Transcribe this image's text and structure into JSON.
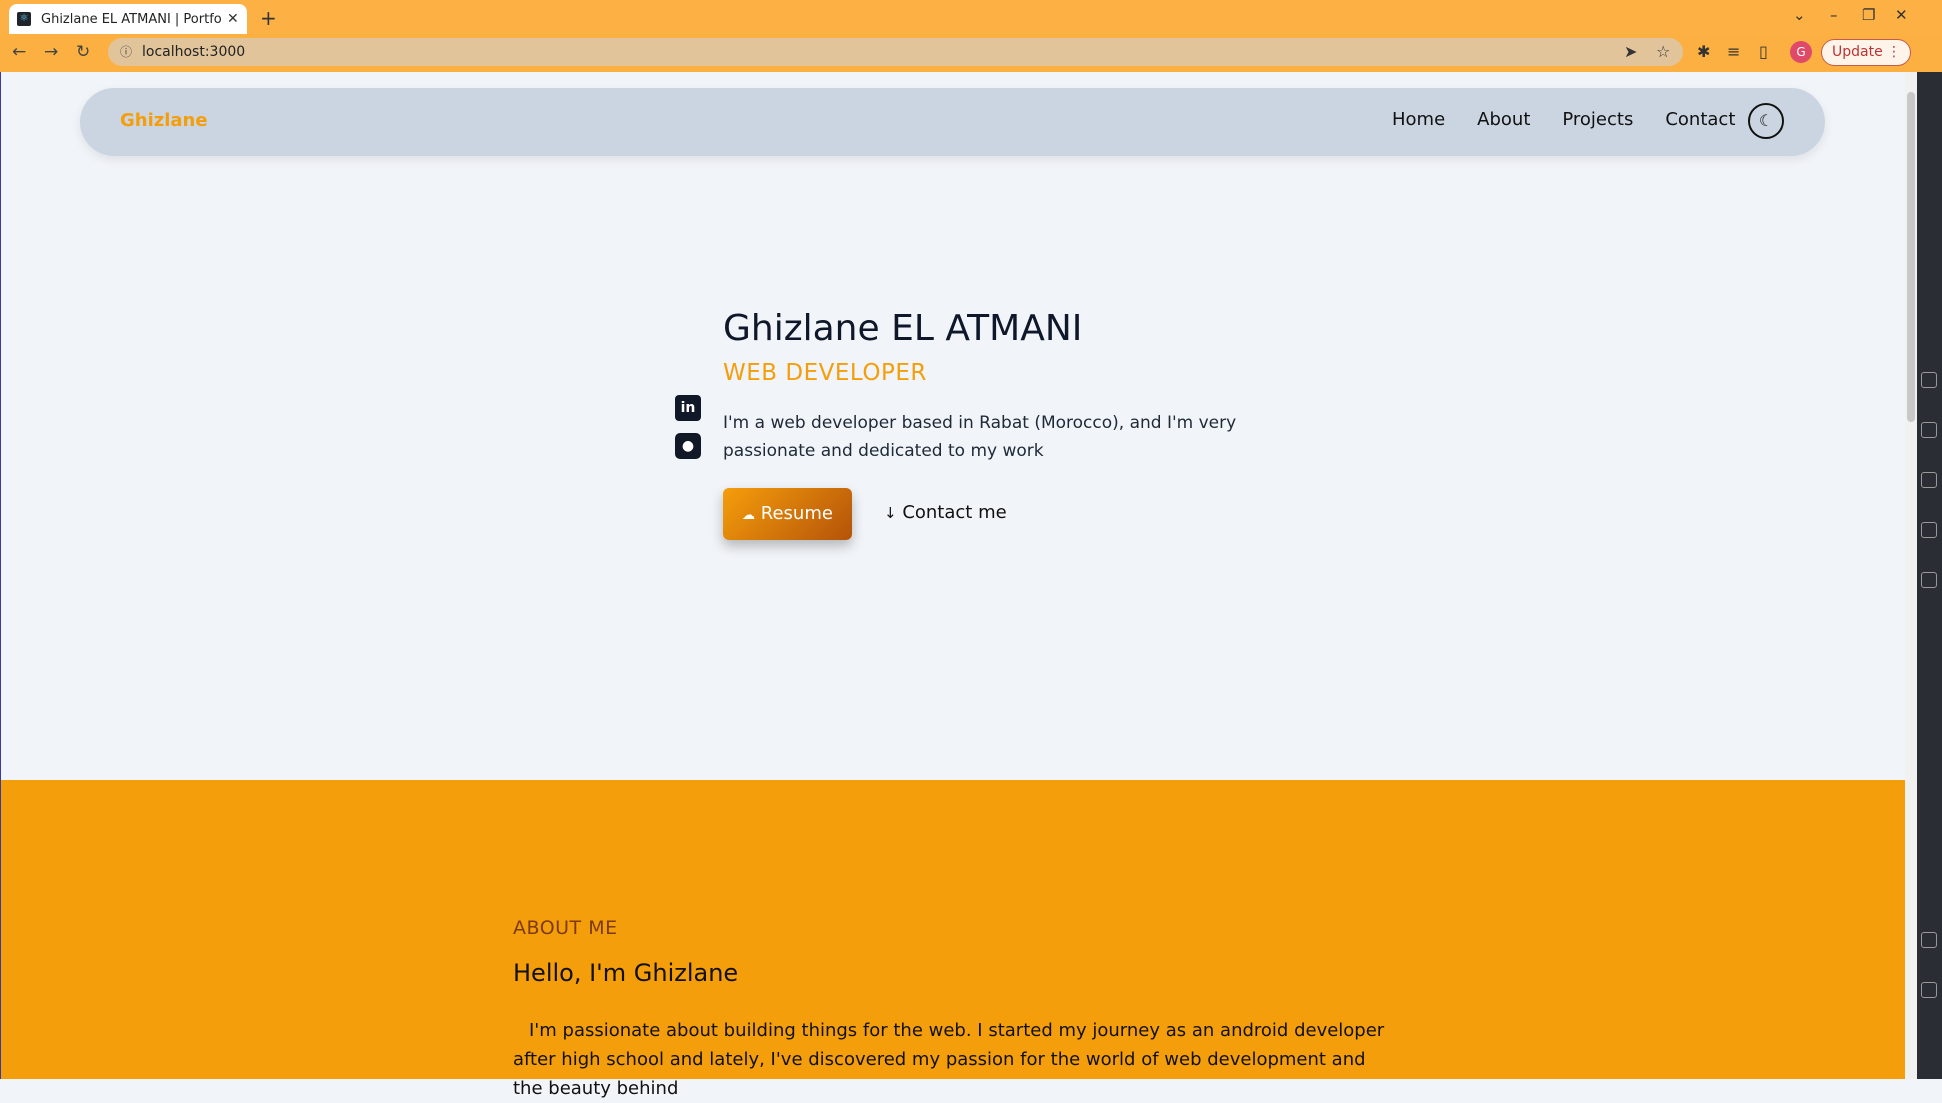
{
  "browser": {
    "tab_title": "Ghizlane EL ATMANI | Portfolio",
    "url": "localhost:3000",
    "update_label": "Update",
    "profile_initial": "G"
  },
  "nav": {
    "brand": "Ghizlane",
    "links": [
      "Home",
      "About",
      "Projects",
      "Contact"
    ]
  },
  "hero": {
    "name": "Ghizlane EL ATMANI",
    "role": "WEB DEVELOPER",
    "description": "I'm a web developer based in Rabat (Morocco), and I'm very passionate and dedicated to my work",
    "resume_label": "Resume",
    "contact_label": "Contact me",
    "socials": [
      "linkedin-icon",
      "github-icon"
    ]
  },
  "about": {
    "label": "ABOUT ME",
    "title": "Hello, I'm Ghizlane",
    "text": "I'm passionate about building things for the web. I started my journey as an android developer after high school and lately, I've discovered my passion for the world of web development and the beauty behind"
  },
  "colors": {
    "accent": "#f59e0b",
    "navbar_bg": "#cbd5e1",
    "page_bg": "#f1f4f8"
  }
}
